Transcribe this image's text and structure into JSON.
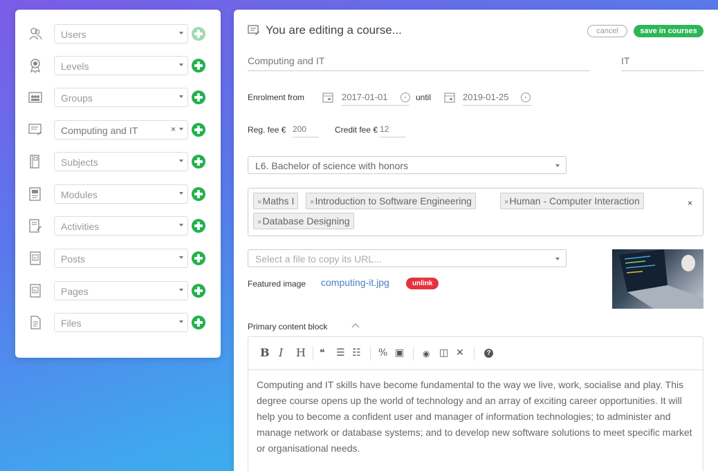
{
  "sidebar": {
    "items": [
      {
        "label": "Users",
        "icon": "users-icon",
        "add_faded": true
      },
      {
        "label": "Levels",
        "icon": "award-icon",
        "add_faded": false
      },
      {
        "label": "Groups",
        "icon": "groups-icon",
        "add_faded": false
      },
      {
        "label": "Computing and IT",
        "icon": "course-icon",
        "add_faded": false
      },
      {
        "label": "Subjects",
        "icon": "subject-icon",
        "add_faded": false
      },
      {
        "label": "Modules",
        "icon": "module-icon",
        "add_faded": false
      },
      {
        "label": "Activities",
        "icon": "activity-icon",
        "add_faded": false
      },
      {
        "label": "Posts",
        "icon": "post-icon",
        "add_faded": false
      },
      {
        "label": "Pages",
        "icon": "page-icon",
        "add_faded": false
      },
      {
        "label": "Files",
        "icon": "file-icon",
        "add_faded": false
      }
    ],
    "clear_symbol": "×"
  },
  "editor": {
    "title": "You are editing a course...",
    "cancel_label": "cancel",
    "save_label": "save in courses",
    "course_name": "Computing and IT",
    "course_code": "IT",
    "enrolment_from_label": "Enrolment from",
    "enrolment_from": "2017-01-01",
    "until_label": "until",
    "enrolment_until": "2019-01-25",
    "reg_fee_label": "Reg. fee €",
    "reg_fee": "200",
    "credit_fee_label": "Credit fee €",
    "credit_fee": "12",
    "level_value": "L6. Bachelor of science with honors",
    "modules": [
      "Maths I",
      "Introduction to Software Engineering",
      "Human - Computer Interaction",
      "Database Designing"
    ],
    "tag_remove": "×",
    "tags_clear": "×",
    "file_placeholder": "Select a file to copy its URL...",
    "featured_label": "Featured image",
    "featured_file": "computing-it.jpg",
    "unlink_label": "unlink",
    "primary_block_label": "Primary content block",
    "body_text": "Computing and IT skills have become fundamental to the way we live, work, socialise and play. This degree course opens up the world of technology and an array of exciting career opportunities. It will help you to become a confident user and manager of information technologies; to administer and manage network or database systems; and to develop new software solutions to meet specific market or organisational needs."
  },
  "toolbar": {
    "bold": "B",
    "italic": "I",
    "heading": "H",
    "quote": "❝",
    "ul": "☰",
    "ol": "☷",
    "link": "%",
    "image": "▣",
    "preview": "◉",
    "side_by_side": "◫",
    "fullscreen": "✕",
    "help": "?"
  },
  "colors": {
    "accent_green": "#22b24c",
    "save_green": "#2db657",
    "unlink_red": "#e5323f",
    "link_blue": "#4a7fc1"
  }
}
